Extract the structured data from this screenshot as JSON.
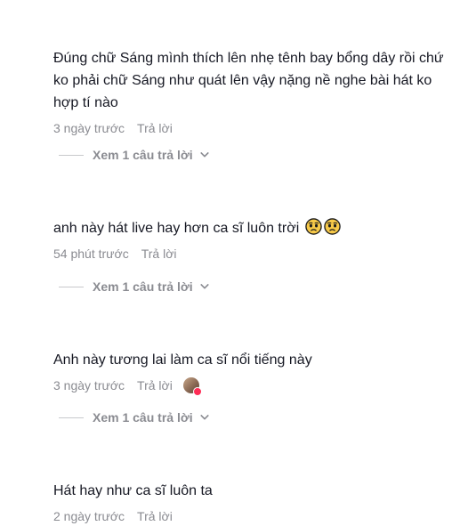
{
  "comments": [
    {
      "text": "Đúng chữ Sáng mình thích lên nhẹ tênh bay bổng dây rồi chứ ko phải chữ Sáng như quát lên vậy nặng nề nghe bài hát ko hợp tí nào",
      "time": "3 ngày trước",
      "reply_label": "Trả lời",
      "view_replies": "Xem 1 câu trả lời"
    },
    {
      "text": "anh này hát live hay hơn ca sĩ luôn trời",
      "emojis": [
        "pleading-face",
        "pleading-face"
      ],
      "time": "54 phút trước",
      "reply_label": "Trả lời",
      "view_replies": "Xem 1 câu trả lời"
    },
    {
      "text": "Anh này tương lai làm ca sĩ nổi tiếng này",
      "time": "3 ngày trước",
      "reply_label": "Trả lời",
      "view_replies": "Xem 1 câu trả lời",
      "liked_by_creator": true
    },
    {
      "text": "Hát hay như ca sĩ luôn ta",
      "time": "2 ngày trước",
      "reply_label": "Trả lời"
    }
  ],
  "colors": {
    "text": "#161823",
    "meta": "#8a8b91",
    "heart": "#fe2c55"
  }
}
